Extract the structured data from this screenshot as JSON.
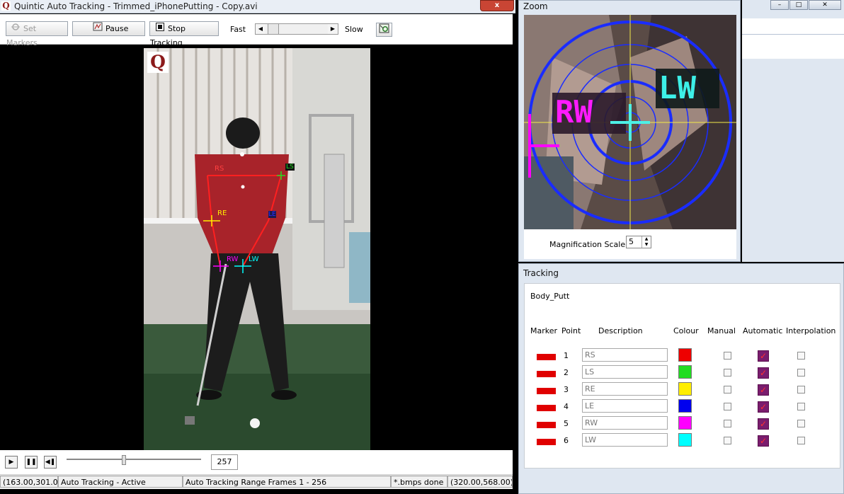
{
  "main_window": {
    "title": "Quintic Auto Tracking - Trimmed_iPhonePutting - Copy.avi",
    "logo_letter": "Q",
    "close_glyph": "x"
  },
  "toolbar": {
    "set_markers": "Set Markers",
    "pause": "Pause",
    "stop_tracking": "Stop Tracking",
    "fast": "Fast",
    "slow": "Slow"
  },
  "video": {
    "labels": {
      "rs": "RS",
      "ls": "LS",
      "re": "RE",
      "le": "LE",
      "rw": "RW",
      "lw": "LW"
    },
    "logo": "Q"
  },
  "playback": {
    "frame_number": "257",
    "frame_position_fraction": 0.42
  },
  "statusbar": {
    "coords_left": "(163.00,301.00)",
    "mode": "Auto Tracking - Active",
    "range": "Auto Tracking Range Frames 1 - 256",
    "bmps": "*.bmps done",
    "coords_right": "(320.00,568.00)"
  },
  "zoom_window": {
    "title": "Zoom",
    "labels": {
      "rw": "RW",
      "lw": "LW"
    },
    "magnification_label": "Magnification Scale",
    "magnification_value": "5"
  },
  "tracking_window": {
    "title": "Tracking",
    "model": "Body_Putt",
    "headers": {
      "marker": "Marker",
      "point": "Point",
      "description": "Description",
      "colour": "Colour",
      "manual": "Manual",
      "automatic": "Automatic",
      "interpolation": "Interpolation"
    },
    "rows": [
      {
        "point": "1",
        "description": "RS",
        "colour": "#ee0000",
        "manual": false,
        "automatic": true,
        "interpolation": false
      },
      {
        "point": "2",
        "description": "LS",
        "colour": "#22dd22",
        "manual": false,
        "automatic": true,
        "interpolation": false
      },
      {
        "point": "3",
        "description": "RE",
        "colour": "#ffee00",
        "manual": false,
        "automatic": true,
        "interpolation": false
      },
      {
        "point": "4",
        "description": "LE",
        "colour": "#0000ee",
        "manual": false,
        "automatic": true,
        "interpolation": false
      },
      {
        "point": "5",
        "description": "RW",
        "colour": "#ff00ff",
        "manual": false,
        "automatic": true,
        "interpolation": false
      },
      {
        "point": "6",
        "description": "LW",
        "colour": "#00ffff",
        "manual": false,
        "automatic": true,
        "interpolation": false
      }
    ]
  },
  "colors": {
    "marker_red": "#e00000",
    "window_chrome": "#dfe7f1",
    "close_red": "#c94534"
  }
}
